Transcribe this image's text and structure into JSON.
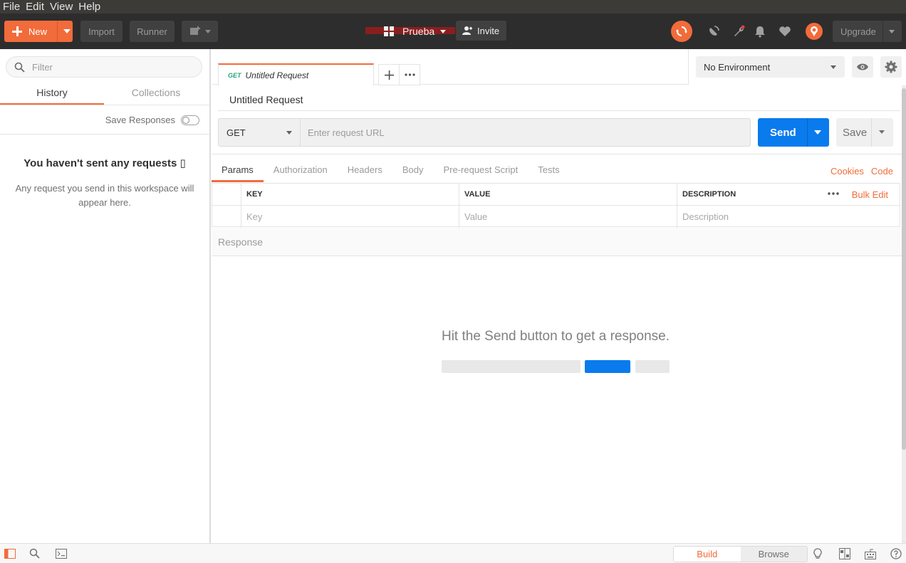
{
  "menubar": {
    "items": [
      "File",
      "Edit",
      "View",
      "Help"
    ]
  },
  "header": {
    "new_label": "New",
    "import_label": "Import",
    "runner_label": "Runner",
    "workspace_name": "Prueba",
    "invite_label": "Invite",
    "upgrade_label": "Upgrade",
    "accent_color": "#f26b3a"
  },
  "sidebar": {
    "filter_placeholder": "Filter",
    "tabs": [
      "History",
      "Collections"
    ],
    "active_tab": "History",
    "save_responses_label": "Save Responses",
    "empty_title": "You haven't sent any requests ▯",
    "empty_subtitle": "Any request you send in this workspace will appear here."
  },
  "request_tab": {
    "method": "GET",
    "title": "Untitled Request"
  },
  "environment": {
    "selected": "No Environment"
  },
  "request": {
    "name": "Untitled Request",
    "method": "GET",
    "url_placeholder": "Enter request URL",
    "send_label": "Send",
    "save_label": "Save",
    "send_color": "#097bed"
  },
  "request_tabs": [
    "Params",
    "Authorization",
    "Headers",
    "Body",
    "Pre-request Script",
    "Tests"
  ],
  "request_links": {
    "cookies": "Cookies",
    "code": "Code"
  },
  "params_table": {
    "headers": [
      "KEY",
      "VALUE",
      "DESCRIPTION"
    ],
    "bulk_edit": "Bulk Edit",
    "placeholders": [
      "Key",
      "Value",
      "Description"
    ]
  },
  "response": {
    "title": "Response",
    "hint": "Hit the Send button to get a response."
  },
  "bottombar": {
    "build_label": "Build",
    "browse_label": "Browse"
  }
}
